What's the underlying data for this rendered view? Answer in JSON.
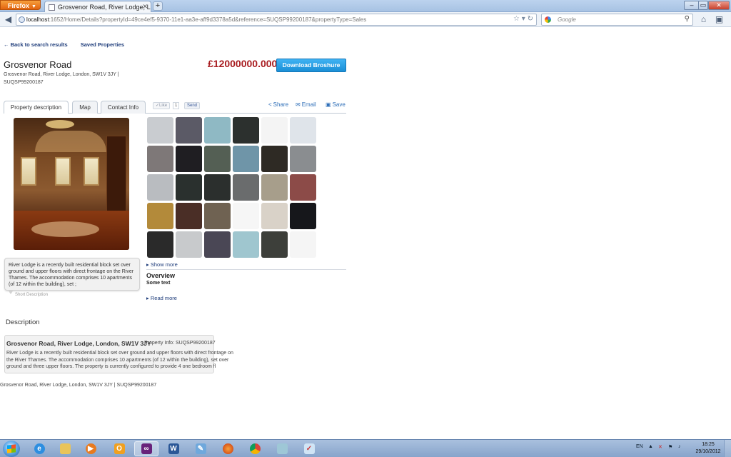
{
  "browser": {
    "app_button": "Firefox",
    "tab_title": "Grosvenor Road, River Lodge, London, S...",
    "new_tab": "+",
    "url_host": "localhost",
    "url_rest": ":1652/Home/Details?propertyId=49ce4ef5-9370-11e1-aa3e-aff9d3378a5d&reference=SUQSP99200187&propertyType=Sales",
    "search_placeholder": "Google"
  },
  "page": {
    "back_link": "Back to search results",
    "saved_link": "Saved Properties",
    "title": "Grosvenor Road",
    "address": "Grosvenor Road, River Lodge, London, SW1V 3JY |",
    "reference": "SUQSP99200187",
    "price": "£12000000.000",
    "download_button": "Download Broshure",
    "tabs": [
      "Property description",
      "Map",
      "Contact Info"
    ],
    "like_label": "Like",
    "like_count": "1",
    "send_label": "Send",
    "share_label": "Share",
    "email_label": "Email",
    "save_label": "Save",
    "show_more": "Show more",
    "overview_heading": "Overview",
    "overview_text": "Some text",
    "read_more": "Read more",
    "tooltip_text": "River Lodge is a recently built residential block set over ground and upper floors with direct frontage on the River Thames. The accommodation comprises 10 apartments (of 12 within the building), set ;",
    "short_description_label": "Short Description",
    "description_heading": "Description",
    "description_title": "Grosvenor Road, River Lodge, London, SW1V 3JY",
    "description_info": "Property Info: SUQSP99200187",
    "description_text": "River Lodge is a recently built residential block set over ground and upper floors with direct frontage on the River Thames. The accommodation comprises 10 apartments (of 12 within the building), set over ground and three upper floors. The property is currently configured to provide 4 one bedroom fl",
    "footer_address": "Grosvenor Road, River Lodge, London, SW1V 3JY | SUQSP99200187"
  },
  "gallery_colors": [
    "#c9ccd0",
    "#5b5a66",
    "#8fb9c4",
    "#2c302e",
    "#f4f4f4",
    "#dfe4ea",
    "#7e7878",
    "#1f1e22",
    "#545f54",
    "#6f95a8",
    "#2e2a24",
    "#8a8d90",
    "#b9bcc0",
    "#2a302e",
    "#2b2f2d",
    "#6a6c6d",
    "#a79e8b",
    "#8c4b48",
    "#b38a3a",
    "#4a2e26",
    "#6f6252",
    "#f6f6f6",
    "#d9d2c8",
    "#16171b",
    "#2a2a2a",
    "#c8cacc",
    "#4a4755",
    "#9fc6cf",
    "#3d3f3a",
    "#f5f5f5"
  ],
  "taskbar": {
    "apps": [
      "explorer-ie",
      "file-explorer",
      "media-player",
      "outlook",
      "visual-studio",
      "word",
      "generic-app",
      "firefox",
      "chrome",
      "notes",
      "paint"
    ],
    "active_app": "visual-studio",
    "language": "EN",
    "time": "18:25",
    "date": "29/10/2012"
  },
  "colors": {
    "price": "#a81c20",
    "link": "#1e3c7a",
    "button": "#1a8fd6"
  }
}
